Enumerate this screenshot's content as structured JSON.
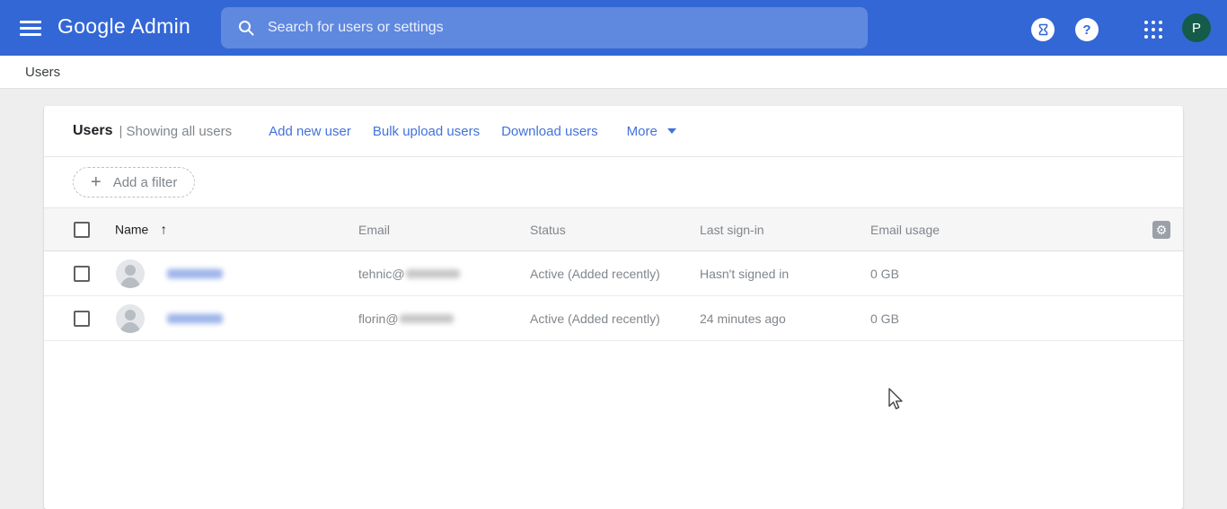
{
  "topbar": {
    "logo_text": "Google Admin",
    "search_placeholder": "Search for users or settings",
    "avatar_initial": "P"
  },
  "breadcrumb": {
    "label": "Users"
  },
  "users_card": {
    "title": "Users",
    "subtitle": "| Showing all users",
    "actions": {
      "add_new_user": "Add new user",
      "bulk_upload_users": "Bulk upload users",
      "download_users": "Download users",
      "more": "More"
    },
    "filter_button_label": "Add a filter"
  },
  "table": {
    "headers": {
      "name": "Name",
      "email": "Email",
      "status": "Status",
      "last_signin": "Last sign-in",
      "email_usage": "Email usage"
    },
    "rows": [
      {
        "email_prefix": "tehnic@",
        "status": "Active (Added recently)",
        "last_signin": "Hasn't signed in",
        "email_usage": "0 GB"
      },
      {
        "email_prefix": "florin@",
        "status": "Active (Added recently)",
        "last_signin": "24 minutes ago",
        "email_usage": "0 GB"
      }
    ]
  },
  "icons": {
    "menu": "hamburger-icon",
    "search": "search-icon",
    "hourglass": "hourglass-icon",
    "help_glyph": "?",
    "apps": "apps-grid-icon",
    "plus_glyph": "+",
    "sort_ascending_glyph": "↑",
    "gear_glyph": "⚙"
  },
  "colors": {
    "topbar_blue": "#3367d6",
    "link_blue": "#4272db",
    "avatar_green": "#155b49",
    "page_background": "#eeeeee",
    "text_gray": "#80868b",
    "text_dark": "#202124"
  }
}
